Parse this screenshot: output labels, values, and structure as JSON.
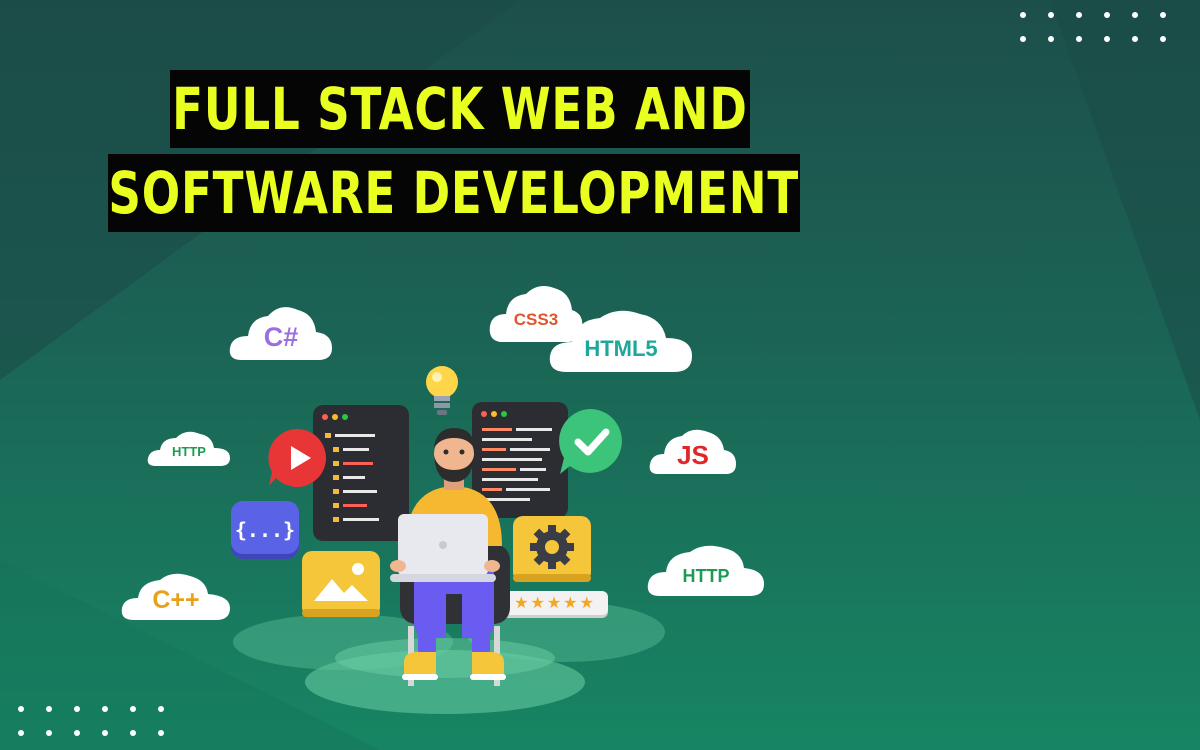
{
  "title": {
    "line1": "FULL STACK WEB AND",
    "line2": "SOFTWARE DEVELOPMENT"
  },
  "clouds": {
    "csharp": "C#",
    "css3": "CSS3",
    "html5": "HTML5",
    "http_left": "HTTP",
    "js": "JS",
    "cpp": "C++",
    "http_right": "HTTP"
  },
  "code_icon": "{...}",
  "rating": {
    "stars": 5,
    "max": 5
  },
  "colors": {
    "title_bg": "#050505",
    "title_text": "#e9ff1f",
    "csharp": "#9b6fe0",
    "css3": "#e0552b",
    "html5": "#1fa89a",
    "http": "#1d9a55",
    "js": "#e02727",
    "cpp": "#e6a21a"
  }
}
